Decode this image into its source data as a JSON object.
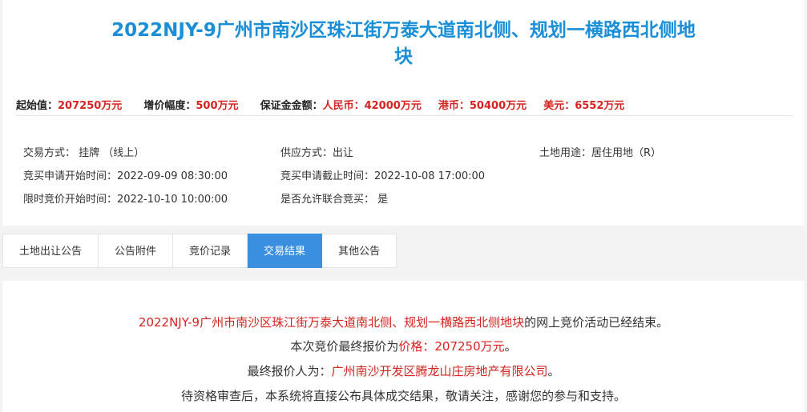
{
  "header": {
    "title_line1": "2022NJY-9广州市南沙区珠江街万泰大道南北侧、规划一横路西北侧地",
    "title_line2": "块"
  },
  "pricing": {
    "start_label": "起始值：",
    "start_value": "207250万元",
    "increment_label": "增价幅度：",
    "increment_value": "500万元",
    "deposit_label": "保证金金额：",
    "rmb_value": "人民币：42000万元",
    "hkd_value": "港币：50400万元",
    "usd_value": "美元：6552万元"
  },
  "details": {
    "trade_mode": "交易方式： 挂牌 （线上）",
    "supply_mode": "供应方式：出让",
    "land_use": "土地用途：居住用地（R）",
    "apply_start": "竞买申请开始时间：2022-09-09 08:30:00",
    "apply_end": "竞买申请截止时间：2022-10-08 17:00:00",
    "bid_start": "限时竞价开始时间：2022-10-10 10:00:00",
    "joint_bid": "是否允许联合竞买： 是"
  },
  "tabs": [
    {
      "label": "土地出让公告"
    },
    {
      "label": "公告附件"
    },
    {
      "label": "竞价记录"
    },
    {
      "label": "交易结果"
    },
    {
      "label": "其他公告"
    }
  ],
  "result": {
    "line1_parcel": "2022NJY-9广州市南沙区珠江街万泰大道南北侧、规划一横路西北侧地块",
    "line1_rest": "的网上竞价活动已经结束。",
    "line2_prefix": "本次竞价最终报价为",
    "line2_price": "价格：207250万元",
    "line2_suffix": "。",
    "line3_prefix": "最终报价人为：",
    "line3_bidder": "广州南沙开发区腾龙山庄房地产有限公司",
    "line3_suffix": "。",
    "line4": "待资格审查后，本系统将直接公布具体成交结果，敬请关注，感谢您的参与和支持。"
  },
  "colors": {
    "title_blue": "#1a8fd8",
    "accent_red": "#d6231f",
    "active_tab": "#3a8fe0"
  }
}
